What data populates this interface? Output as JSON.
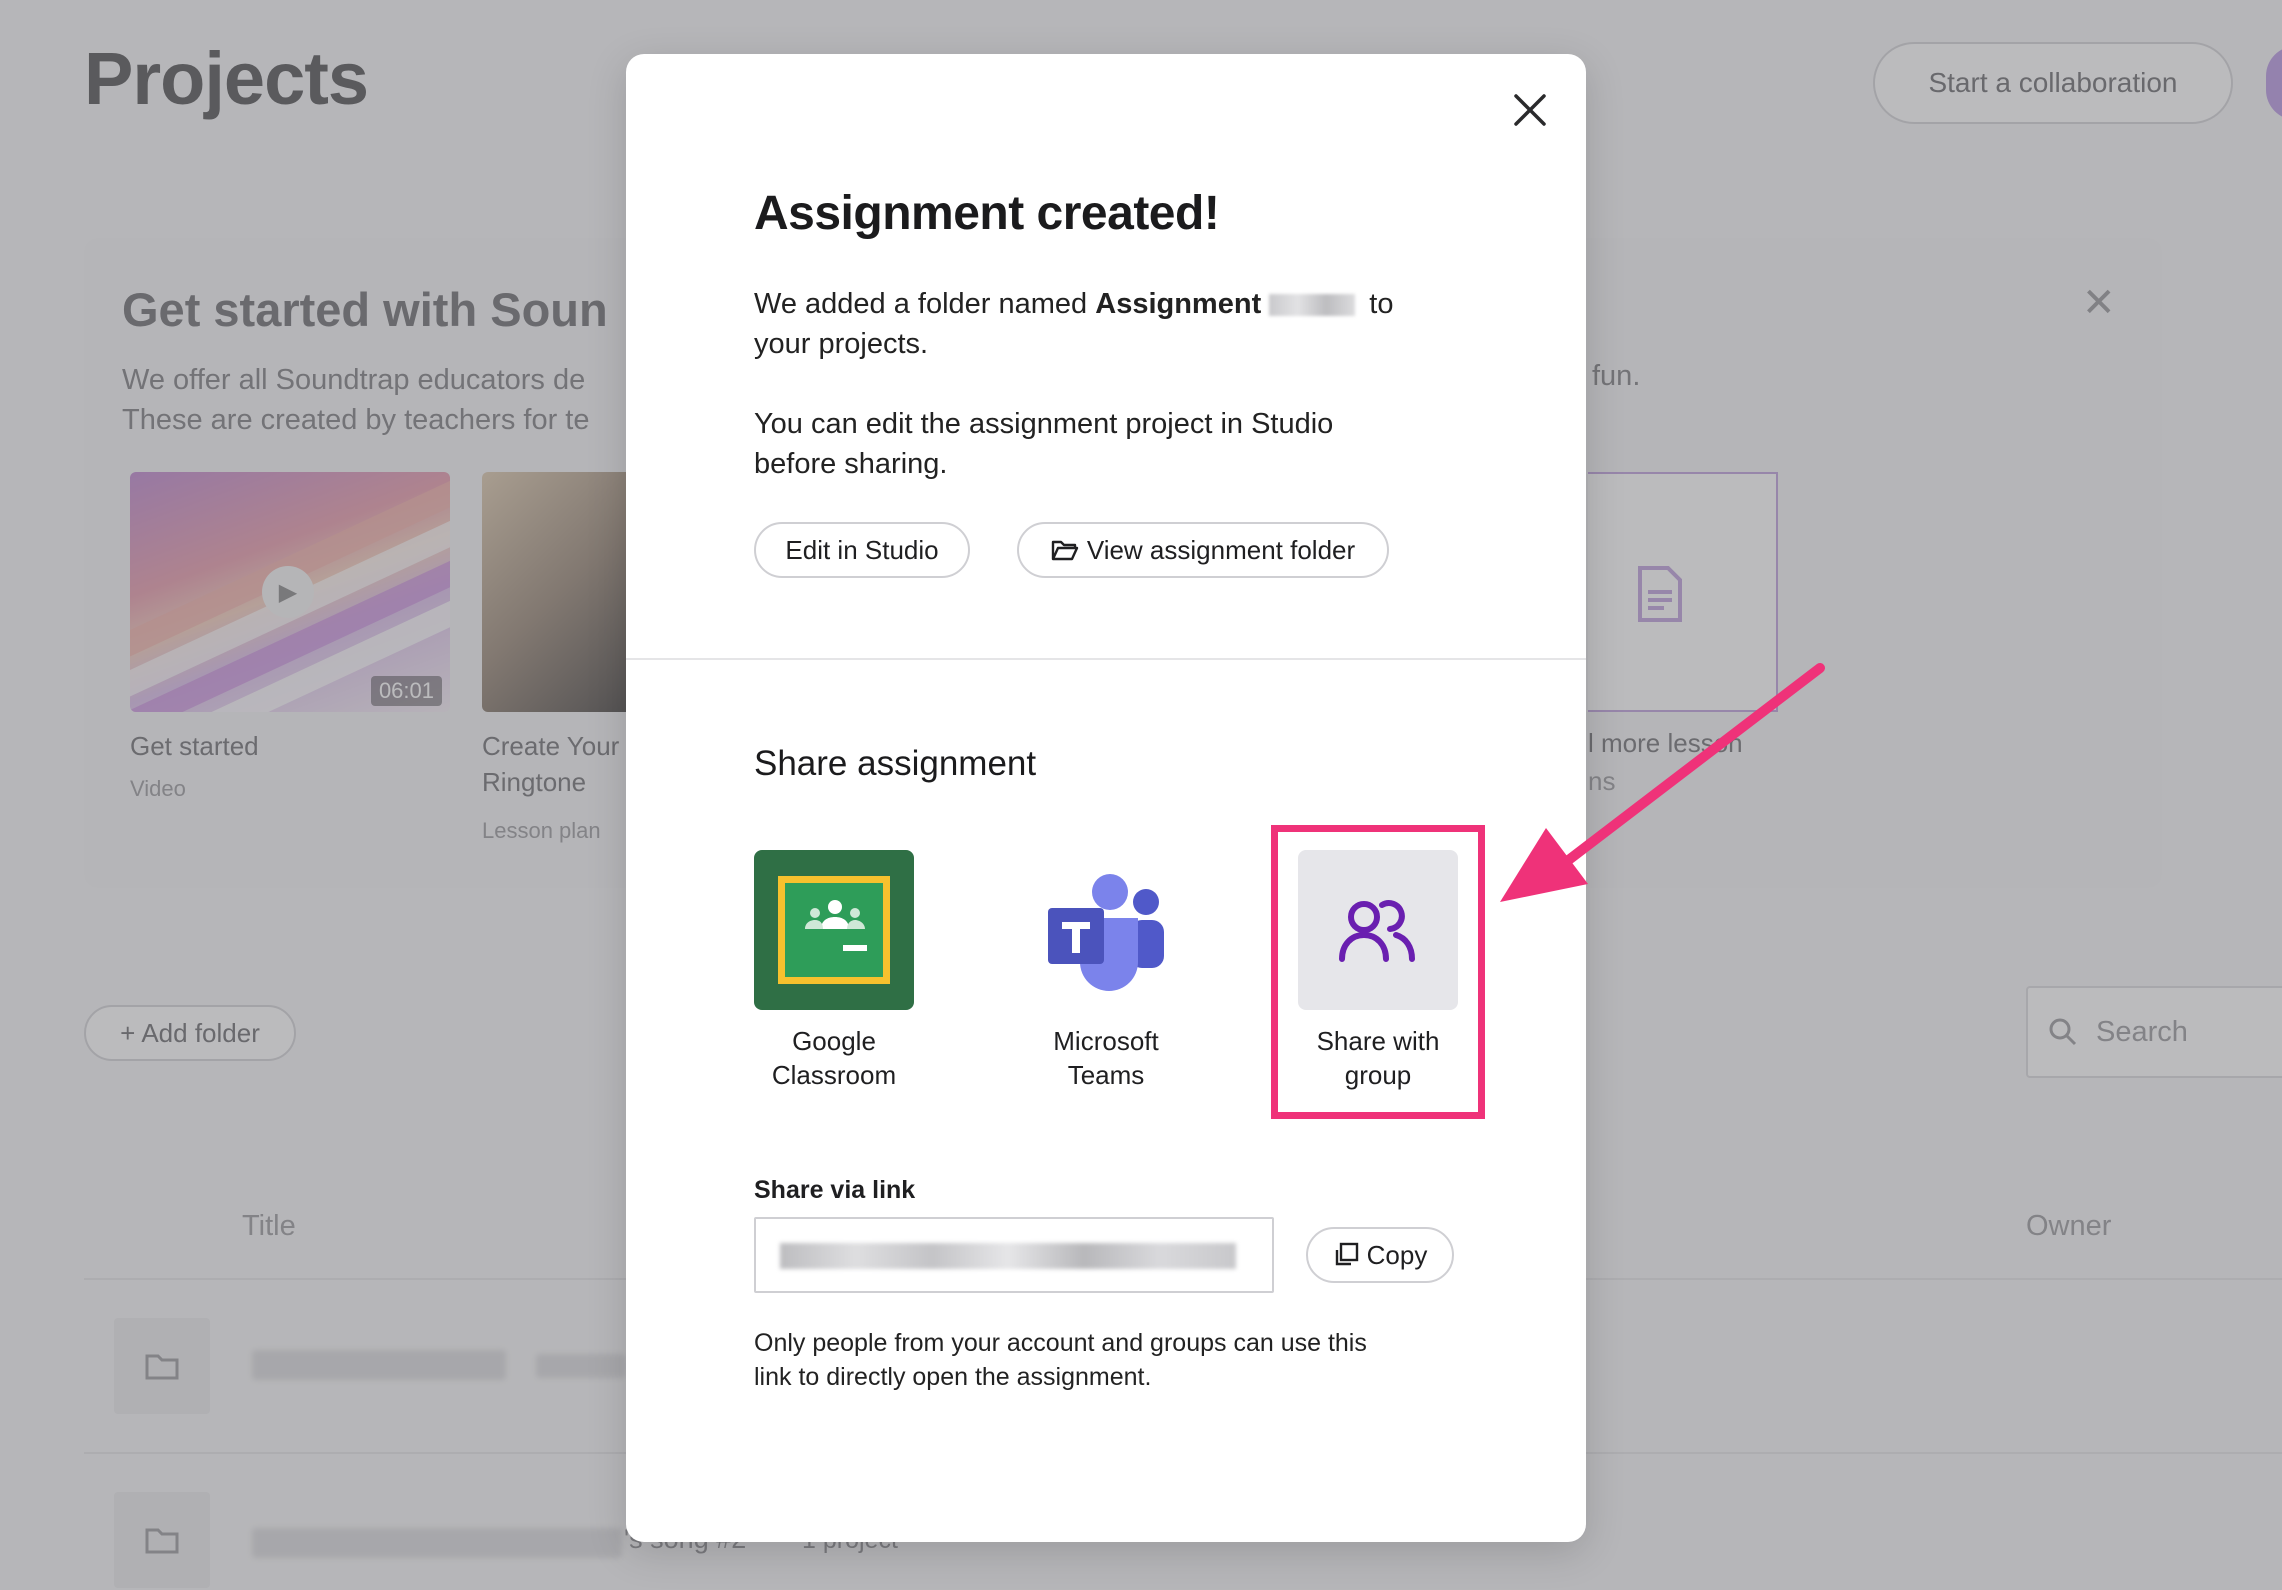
{
  "background": {
    "page_title": "Projects",
    "collab_button": "Start a collaboration",
    "banner": {
      "title": "Get started with Soun",
      "text_line1": "We offer all Soundtrap educators de",
      "text_line2": "These are created by teachers for te",
      "text_right": "fun.",
      "cards": [
        {
          "title": "Get started",
          "subtitle": "Video",
          "duration": "06:01"
        },
        {
          "title_line1": "Create Your",
          "title_line2": "Ringtone",
          "subtitle": "Lesson plan"
        },
        {
          "title": "l more lesson",
          "subtitle": "ns"
        }
      ]
    },
    "add_folder": "Add folder",
    "search_placeholder": "Search",
    "columns": {
      "title": "Title",
      "owner": "Owner"
    },
    "rows": [
      {
        "name": "",
        "meta": ""
      },
      {
        "name": "'s song #2",
        "meta": "1 project"
      }
    ]
  },
  "modal": {
    "title": "Assignment created!",
    "desc_prefix": "We added a folder named ",
    "desc_bold": "Assignment",
    "desc_suffix": " to",
    "desc_line2": "your projects.",
    "edit_note_line1": "You can edit the assignment project in Studio",
    "edit_note_line2": "before sharing.",
    "edit_button": "Edit in Studio",
    "view_button": "View assignment folder",
    "share_title": "Share assignment",
    "options": [
      {
        "label_line1": "Google",
        "label_line2": "Classroom",
        "icon": "google-classroom-icon"
      },
      {
        "label_line1": "Microsoft",
        "label_line2": "Teams",
        "icon": "microsoft-teams-icon"
      },
      {
        "label_line1": "Share with",
        "label_line2": "group",
        "icon": "group-icon"
      }
    ],
    "link_label": "Share via link",
    "copy_button": "Copy",
    "note_line1": "Only people from your account and groups can use this",
    "note_line2": "link to directly open the assignment."
  },
  "colors": {
    "highlight": "#ef3279",
    "group_icon": "#6a1fb0",
    "teams": "#5059c9",
    "classroom_green": "#2f6f45",
    "classroom_yellow": "#f6c12e"
  }
}
